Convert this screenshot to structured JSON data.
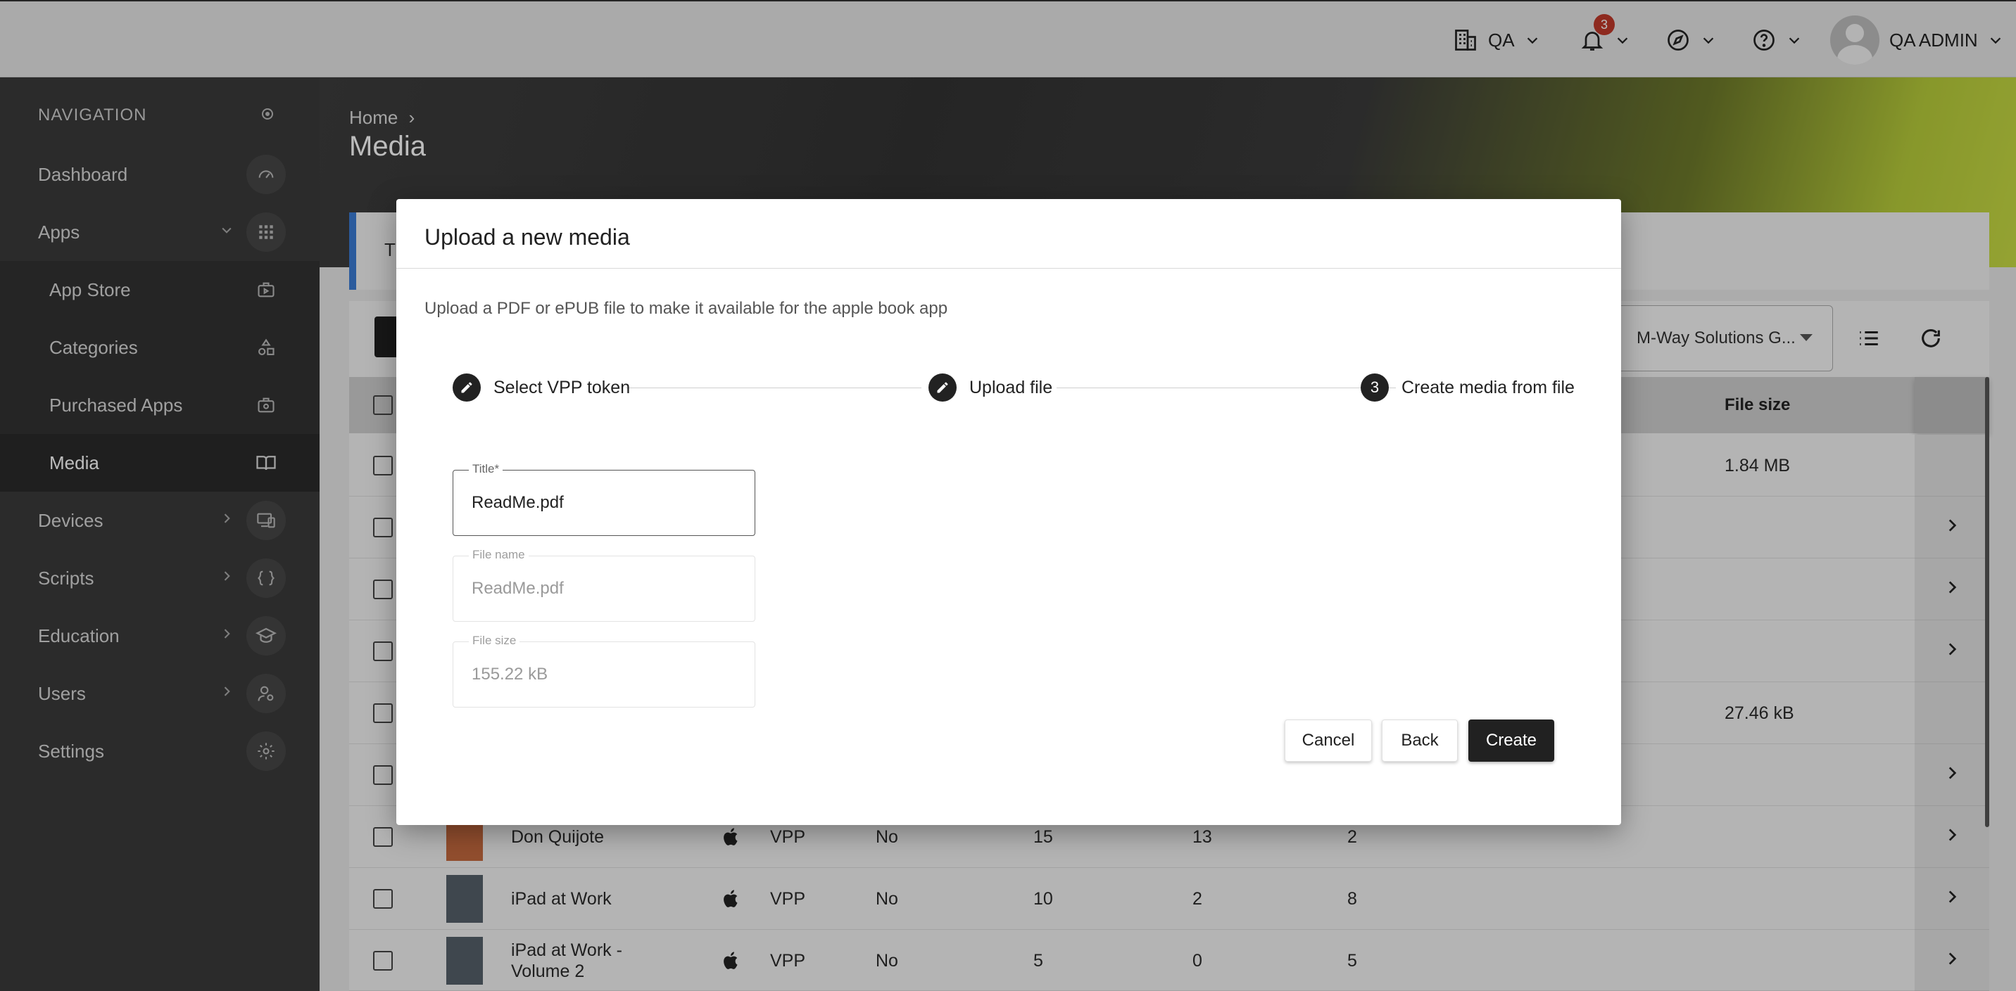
{
  "topbar": {
    "org_label": "QA",
    "notifications_count": "3",
    "user_name": "QA ADMIN"
  },
  "sidebar": {
    "header": "NAVIGATION",
    "items": [
      {
        "label": "Dashboard",
        "icon": "dashboard-icon"
      },
      {
        "label": "Apps",
        "icon": "apps-grid-icon"
      },
      {
        "label": "App Store",
        "icon": "app-store-icon"
      },
      {
        "label": "Categories",
        "icon": "categories-icon"
      },
      {
        "label": "Purchased Apps",
        "icon": "purchased-apps-icon"
      },
      {
        "label": "Media",
        "icon": "book-icon"
      },
      {
        "label": "Devices",
        "icon": "devices-icon"
      },
      {
        "label": "Scripts",
        "icon": "scripts-icon"
      },
      {
        "label": "Education",
        "icon": "education-icon"
      },
      {
        "label": "Users",
        "icon": "users-icon"
      },
      {
        "label": "Settings",
        "icon": "gear-icon"
      }
    ]
  },
  "page": {
    "breadcrumb_home": "Home",
    "title": "Media",
    "info_text": "T"
  },
  "table": {
    "filter_value": "M-Way Solutions G...",
    "col_file_size": "File size",
    "rows": [
      {
        "file_size": "1.84 MB"
      },
      {},
      {},
      {},
      {
        "file_size": "27.46 kB"
      },
      {},
      {
        "title": "Don Quijote",
        "type": "VPP",
        "flag": "No",
        "n1": "15",
        "n2": "13",
        "n3": "2"
      },
      {
        "title": "iPad at Work",
        "type": "VPP",
        "flag": "No",
        "n1": "10",
        "n2": "2",
        "n3": "8"
      },
      {
        "title_line1": "iPad at Work -",
        "title_line2": "Volume 2",
        "type": "VPP",
        "flag": "No",
        "n1": "5",
        "n2": "0",
        "n3": "5"
      }
    ]
  },
  "dialog": {
    "title": "Upload a new media",
    "description": "Upload a PDF or ePUB file to make it available for the apple book app",
    "steps": [
      {
        "label": "Select VPP token",
        "state": "done"
      },
      {
        "label": "Upload file",
        "state": "done"
      },
      {
        "number": "3",
        "label": "Create media from file",
        "state": "active"
      }
    ],
    "fields": {
      "title_label": "Title*",
      "title_value": "ReadMe.pdf",
      "filename_label": "File name",
      "filename_value": "ReadMe.pdf",
      "filesize_label": "File size",
      "filesize_value": "155.22 kB"
    },
    "buttons": {
      "cancel": "Cancel",
      "back": "Back",
      "create": "Create"
    }
  }
}
